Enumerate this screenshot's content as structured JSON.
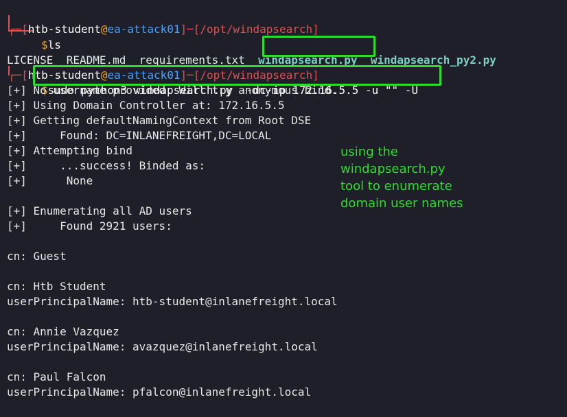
{
  "prompt1": {
    "user": "htb-student",
    "at": "@",
    "host": "ea-attack01",
    "path": "/opt/windapsearch",
    "command": "ls"
  },
  "ls_output": {
    "files": [
      "LICENSE",
      "README.md",
      "requirements.txt"
    ],
    "highlighted_file": "windapsearch.py",
    "other_file": "windapsearch_py2.py"
  },
  "prompt2": {
    "user": "htb-student",
    "at": "@",
    "host": "ea-attack01",
    "path": "/opt/windapsearch",
    "command": "sudo python3 windapsearch.py --dc-ip 172.16.5.5 -u \"\" -U"
  },
  "output_lines": [
    "[+] No username provided. Will try anonymous bind.",
    "[+] Using Domain Controller at: 172.16.5.5",
    "[+] Getting defaultNamingContext from Root DSE",
    "[+]     Found: DC=INLANEFREIGHT,DC=LOCAL",
    "[+] Attempting bind",
    "[+]     ...success! Binded as:",
    "[+]      None",
    "",
    "[+] Enumerating all AD users",
    "[+]     Found 2921 users:",
    "",
    "cn: Guest",
    "",
    "cn: Htb Student",
    "userPrincipalName: htb-student@inlanefreight.local",
    "",
    "cn: Annie Vazquez",
    "userPrincipalName: avazquez@inlanefreight.local",
    "",
    "cn: Paul Falcon",
    "userPrincipalName: pfalcon@inlanefreight.local"
  ],
  "annotation": "using the\nwindapsearch.py\ntool to enumerate\ndomain user names",
  "colors": {
    "background": "#1e1f29",
    "highlight_box": "#2fdc2f",
    "prompt_bracket": "#e05252",
    "host": "#4aa3ff",
    "dollar": "#f0a51e"
  }
}
